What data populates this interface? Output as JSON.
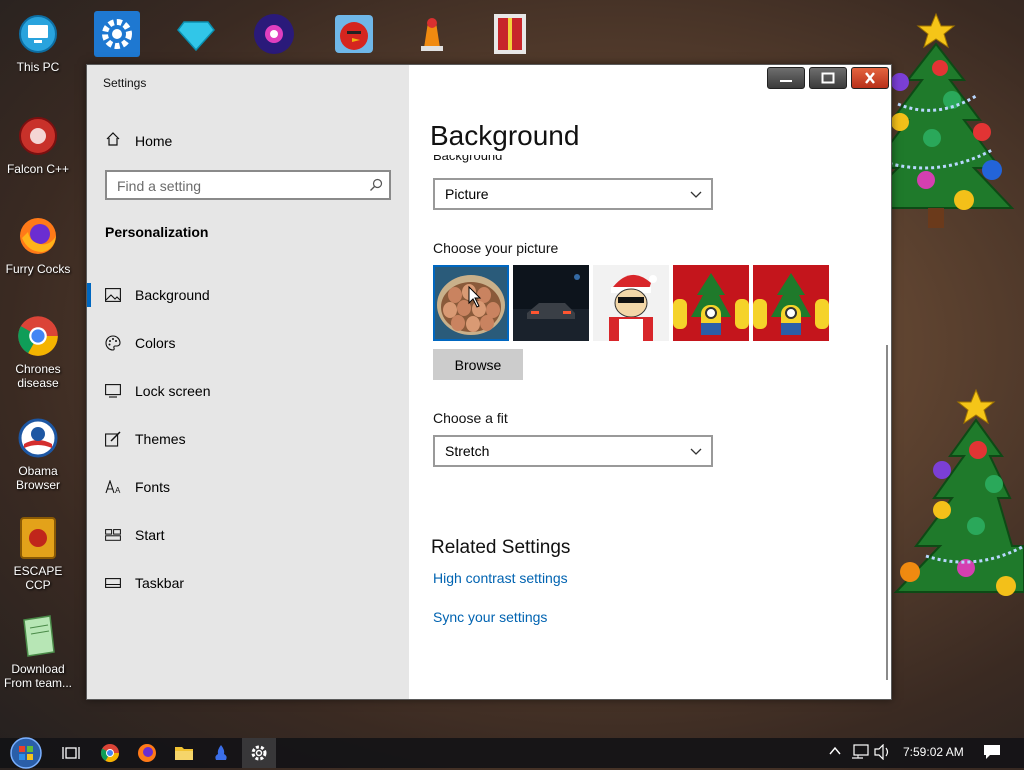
{
  "desktop": {
    "icons": [
      {
        "name": "desk-icon-this-pc",
        "label": "This PC"
      },
      {
        "name": "desk-icon-falcon",
        "label": "Falcon C++"
      },
      {
        "name": "desk-icon-firefox",
        "label": "Furry Cocks"
      },
      {
        "name": "desk-icon-chrome",
        "label": "Chrones disease"
      },
      {
        "name": "desk-icon-obama",
        "label": "Obama Browser"
      },
      {
        "name": "desk-icon-escape",
        "label": "ESCAPE CCP"
      },
      {
        "name": "desk-icon-download",
        "label": "Download From team..."
      }
    ]
  },
  "window": {
    "app_title": "Settings",
    "sidebar": {
      "home_label": "Home",
      "search_placeholder": "Find a setting",
      "section_title": "Personalization",
      "items": [
        {
          "label": "Background",
          "icon": "image-icon",
          "active": true
        },
        {
          "label": "Colors",
          "icon": "palette-icon",
          "active": false
        },
        {
          "label": "Lock screen",
          "icon": "lock-screen-icon",
          "active": false
        },
        {
          "label": "Themes",
          "icon": "themes-icon",
          "active": false
        },
        {
          "label": "Fonts",
          "icon": "fonts-icon",
          "active": false
        },
        {
          "label": "Start",
          "icon": "start-icon",
          "active": false
        },
        {
          "label": "Taskbar",
          "icon": "taskbar-icon",
          "active": false
        }
      ]
    },
    "main": {
      "page_title": "Background",
      "background_label": "Background",
      "background_value": "Picture",
      "choose_picture_label": "Choose your picture",
      "browse_label": "Browse",
      "choose_fit_label": "Choose a fit",
      "fit_value": "Stretch",
      "related_title": "Related Settings",
      "links": [
        "High contrast settings",
        "Sync your settings"
      ]
    }
  },
  "taskbar": {
    "time": "7:59:02 AM"
  }
}
